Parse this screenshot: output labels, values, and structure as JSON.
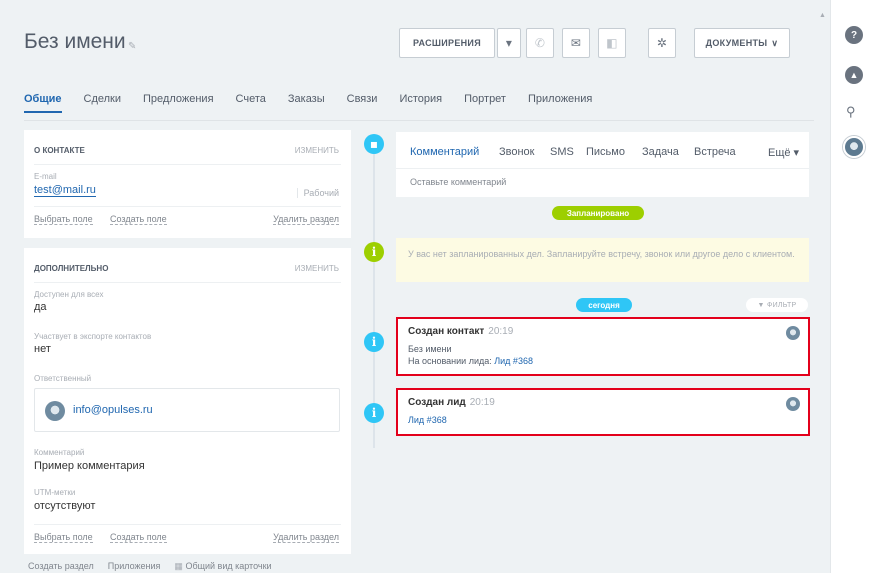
{
  "header": {
    "title": "Без имени",
    "extensions_label": "РАСШИРЕНИЯ",
    "documents_label": "ДОКУМЕНТЫ",
    "documents_caret": "∨"
  },
  "tabs": [
    {
      "label": "Общие"
    },
    {
      "label": "Сделки"
    },
    {
      "label": "Предложения"
    },
    {
      "label": "Счета"
    },
    {
      "label": "Заказы"
    },
    {
      "label": "Связи"
    },
    {
      "label": "История"
    },
    {
      "label": "Портрет"
    },
    {
      "label": "Приложения"
    }
  ],
  "contact_section": {
    "heading": "О КОНТАКТЕ",
    "edit": "изменить",
    "email_label": "E-mail",
    "email_value": "test@mail.ru",
    "email_type": "Рабочий",
    "select_field": "Выбрать поле",
    "create_field": "Создать поле",
    "delete_section": "Удалить раздел"
  },
  "extra_section": {
    "heading": "ДОПОЛНИТЕЛЬНО",
    "edit": "изменить",
    "available_label": "Доступен для всех",
    "available_value": "да",
    "export_label": "Участвует в экспорте контактов",
    "export_value": "нет",
    "responsible_label": "Ответственный",
    "responsible_value": "info@opulses.ru",
    "comment_label": "Комментарий",
    "comment_value": "Пример комментария",
    "utm_label": "UTM-метки",
    "utm_value": "отсутствуют",
    "select_field": "Выбрать поле",
    "create_field": "Создать поле",
    "delete_section": "Удалить раздел"
  },
  "footer": {
    "create_section": "Создать раздел",
    "apps": "Приложения",
    "general_view": "Общий вид карточки"
  },
  "composer": {
    "tabs": [
      "Комментарий",
      "Звонок",
      "SMS",
      "Письмо",
      "Задача",
      "Встреча"
    ],
    "more": "Ещё ▾",
    "placeholder": "Оставьте комментарий"
  },
  "timeline": {
    "planned_pill": "Запланировано",
    "empty_note": "У вас нет запланированных дел. Запланируйте встречу, звонок или другое дело с клиентом.",
    "today_pill": "сегодня",
    "filter": "▼ ФИЛЬТР",
    "events": [
      {
        "title": "Создан контакт",
        "time": "20:19",
        "line1": "Без имени",
        "line2_prefix": "На основании лида:",
        "line2_link": "Лид #368"
      },
      {
        "title": "Создан лид",
        "time": "20:19",
        "link": "Лид #368"
      }
    ]
  },
  "colors": {
    "accent": "#2067b0",
    "timeline_green": "#9dcf00",
    "timeline_blue": "#2fc6f6",
    "highlight_red": "#e3001b"
  },
  "icons": {
    "header": [
      "phone-icon",
      "mail-icon",
      "chat-icon",
      "gear-icon"
    ],
    "rail": [
      "help-icon",
      "bell-icon",
      "search-icon",
      "user-avatar"
    ]
  }
}
